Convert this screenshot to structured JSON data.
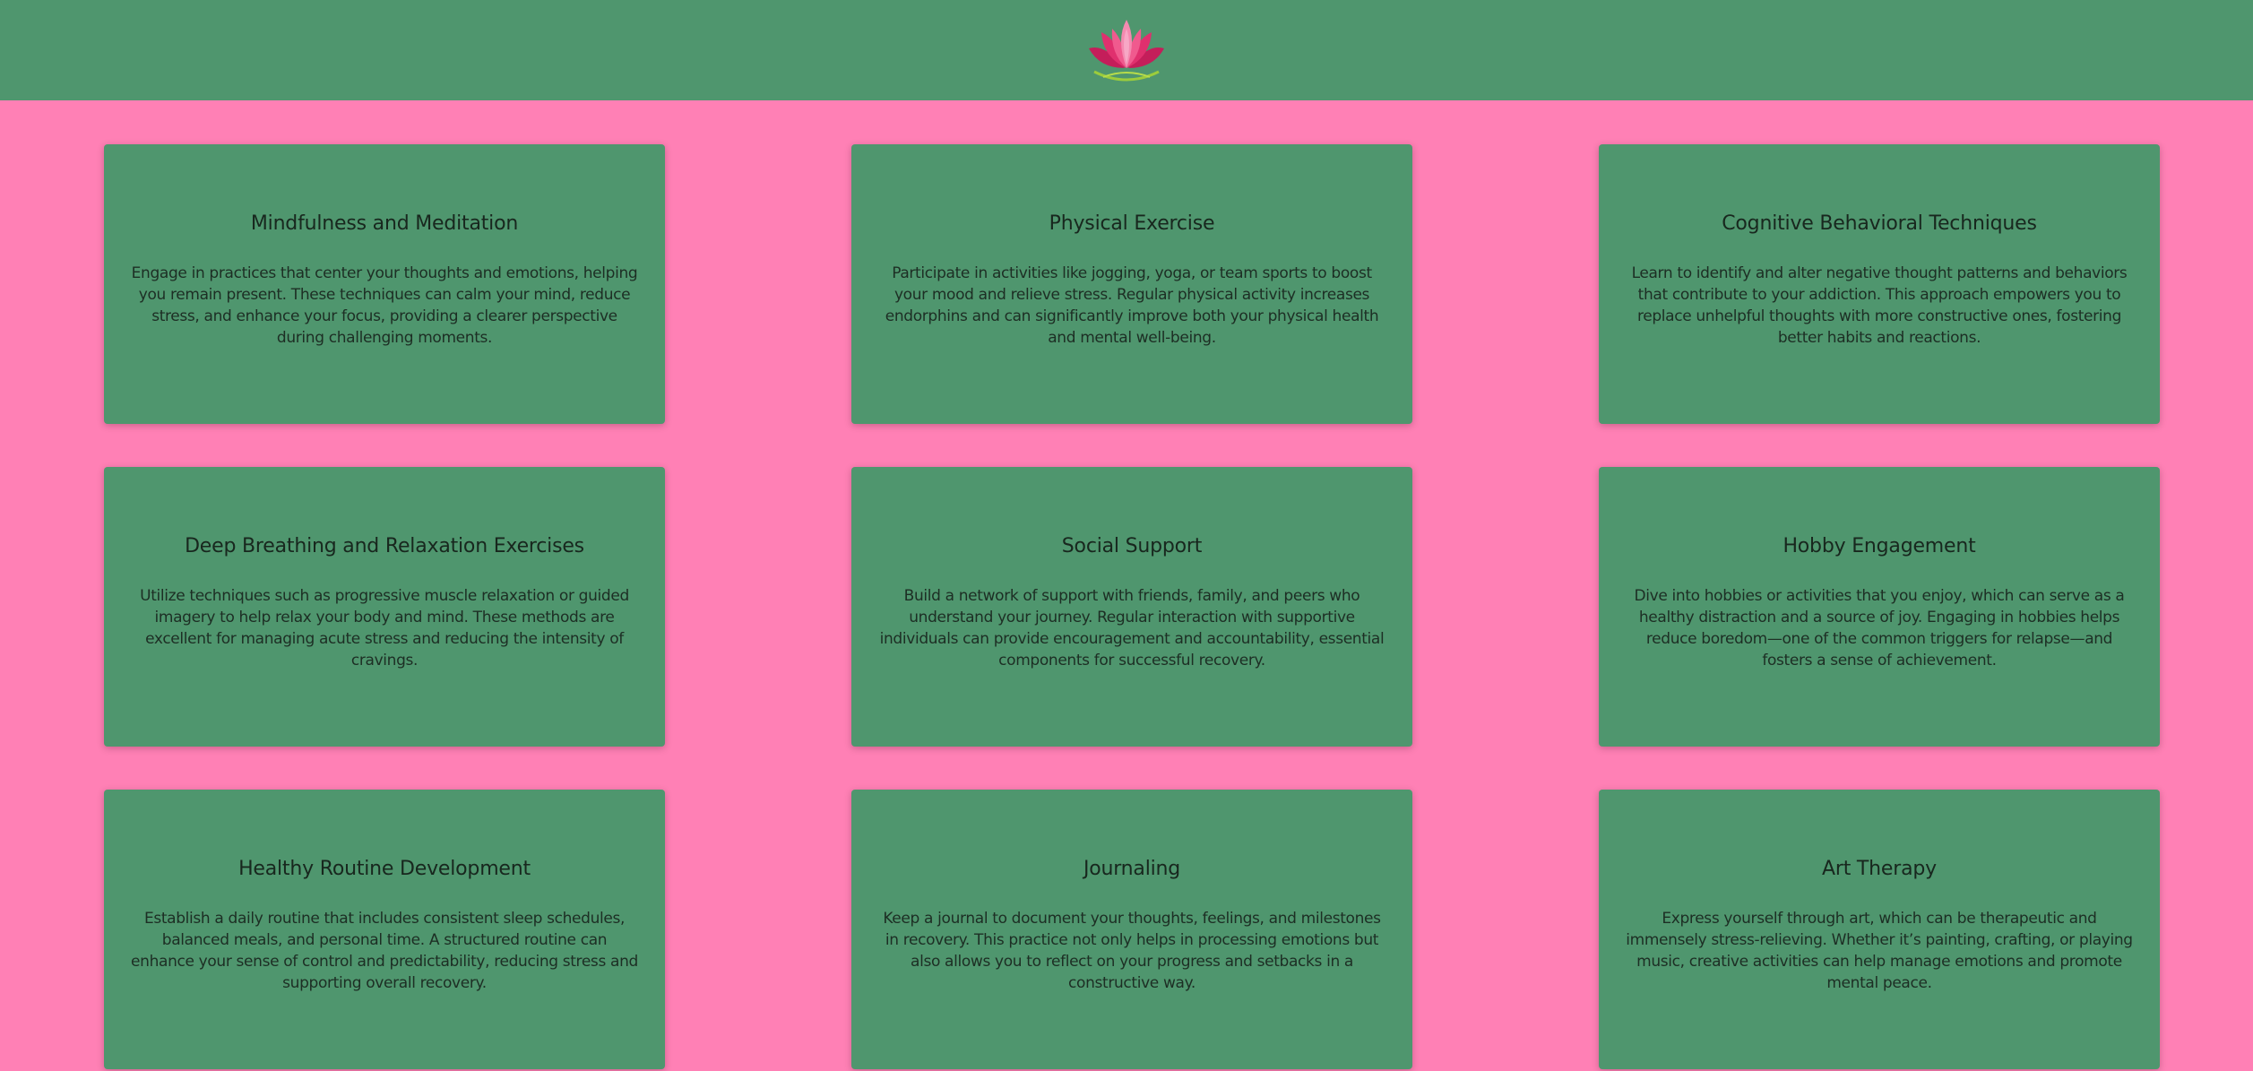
{
  "header": {
    "logo_icon": "lotus-flower-icon"
  },
  "colors": {
    "background": "#ff80b5",
    "header": "#4f966e",
    "card": "#4f966e",
    "text": "#1d2e24"
  },
  "cards": [
    {
      "title": "Mindfulness and Meditation",
      "text": "Engage in practices that center your thoughts and emotions, helping you remain present. These techniques can calm your mind, reduce stress, and enhance your focus, providing a clearer perspective during challenging moments."
    },
    {
      "title": "Physical Exercise",
      "text": "Participate in activities like jogging, yoga, or team sports to boost your mood and relieve stress. Regular physical activity increases endorphins and can significantly improve both your physical health and mental well-being."
    },
    {
      "title": "Cognitive Behavioral Techniques",
      "text": "Learn to identify and alter negative thought patterns and behaviors that contribute to your addiction. This approach empowers you to replace unhelpful thoughts with more constructive ones, fostering better habits and reactions."
    },
    {
      "title": "Deep Breathing and Relaxation Exercises",
      "text": "Utilize techniques such as progressive muscle relaxation or guided imagery to help relax your body and mind. These methods are excellent for managing acute stress and reducing the intensity of cravings."
    },
    {
      "title": "Social Support",
      "text": "Build a network of support with friends, family, and peers who understand your journey. Regular interaction with supportive individuals can provide encouragement and accountability, essential components for successful recovery."
    },
    {
      "title": "Hobby Engagement",
      "text": "Dive into hobbies or activities that you enjoy, which can serve as a healthy distraction and a source of joy. Engaging in hobbies helps reduce boredom—one of the common triggers for relapse—and fosters a sense of achievement."
    },
    {
      "title": "Healthy Routine Development",
      "text": "Establish a daily routine that includes consistent sleep schedules, balanced meals, and personal time. A structured routine can enhance your sense of control and predictability, reducing stress and supporting overall recovery."
    },
    {
      "title": "Journaling",
      "text": "Keep a journal to document your thoughts, feelings, and milestones in recovery. This practice not only helps in processing emotions but also allows you to reflect on your progress and setbacks in a constructive way."
    },
    {
      "title": "Art Therapy",
      "text": "Express yourself through art, which can be therapeutic and immensely stress-relieving. Whether it’s painting, crafting, or playing music, creative activities can help manage emotions and promote mental peace."
    }
  ]
}
